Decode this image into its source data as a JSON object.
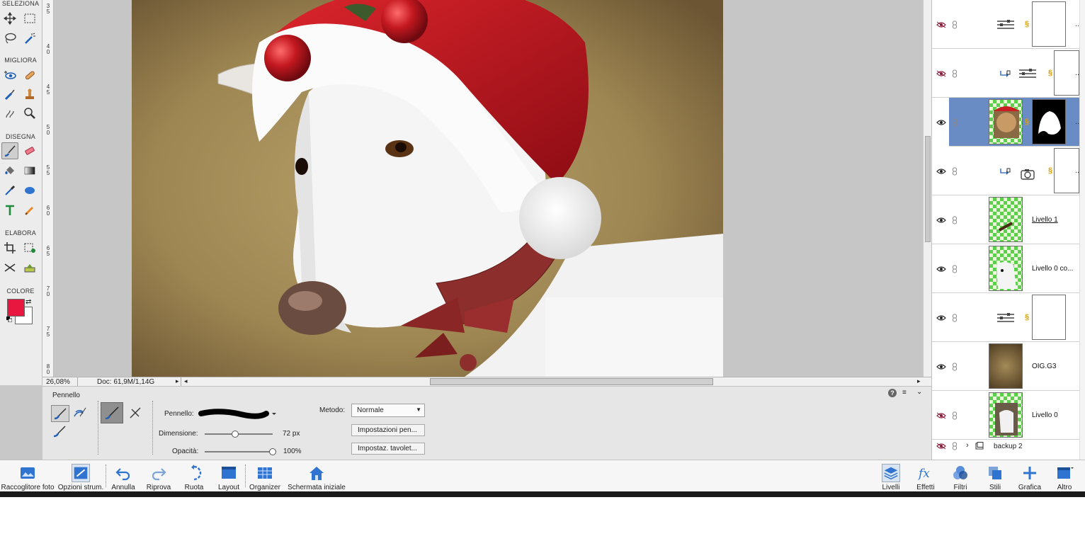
{
  "toolbox": {
    "sections": [
      "SELEZIONA",
      "MIGLIORA",
      "DISEGNA",
      "ELABORA",
      "COLORE"
    ],
    "foreground_color": "#e8173f",
    "background_color": "#ffffff"
  },
  "ruler": {
    "ticks": [
      "3\n5",
      "4\n0",
      "4\n5",
      "5\n0",
      "5\n5",
      "6\n0",
      "6\n5",
      "7\n0",
      "7\n5",
      "8\n0"
    ]
  },
  "status": {
    "zoom": "26,08%",
    "doc": "Doc: 61,9M/1,14G"
  },
  "options": {
    "tool_name": "Pennello",
    "brush_label": "Pennello:",
    "size_label": "Dimensione:",
    "size_value": "72 px",
    "size_level_pct": 45,
    "opacity_label": "Opacità:",
    "opacity_value": "100%",
    "opacity_level_pct": 100,
    "mode_label": "Metodo:",
    "mode_value": "Normale",
    "pen_settings": "Impostazioni pen...",
    "tablet_settings": "Impostaz. tavolet..."
  },
  "layers": [
    {
      "name": "",
      "visible": false,
      "type": "adjustment",
      "more": "..."
    },
    {
      "name": "",
      "visible": false,
      "type": "adjustment-clip",
      "more": "..."
    },
    {
      "name": "",
      "visible": true,
      "type": "photo-mask",
      "selected": true,
      "more": "..."
    },
    {
      "name": "",
      "visible": true,
      "type": "camera-clip",
      "more": "..."
    },
    {
      "name": "Livello 1",
      "visible": true,
      "type": "pixel"
    },
    {
      "name": "Livello 0 co...",
      "visible": true,
      "type": "pixel-dog"
    },
    {
      "name": "",
      "visible": true,
      "type": "adjustment-plain"
    },
    {
      "name": "OIG.G3",
      "visible": true,
      "type": "texture"
    },
    {
      "name": "Livello 0",
      "visible": false,
      "type": "pixel-dog2"
    }
  ],
  "group": {
    "name": "backup 2",
    "visible": false
  },
  "taskbar": {
    "left": [
      {
        "label": "Raccoglitore foto",
        "icon": "photo-bin-icon"
      },
      {
        "label": "Opzioni strum.",
        "icon": "tool-options-icon"
      },
      {
        "label": "Annulla",
        "icon": "undo-icon"
      },
      {
        "label": "Riprova",
        "icon": "redo-icon"
      },
      {
        "label": "Ruota",
        "icon": "rotate-icon"
      },
      {
        "label": "Layout",
        "icon": "layout-icon"
      },
      {
        "label": "Organizer",
        "icon": "organizer-icon"
      },
      {
        "label": "Schermata iniziale",
        "icon": "home-icon"
      }
    ],
    "right": [
      {
        "label": "Livelli",
        "icon": "layers-icon"
      },
      {
        "label": "Effetti",
        "icon": "fx-icon"
      },
      {
        "label": "Filtri",
        "icon": "filters-icon"
      },
      {
        "label": "Stili",
        "icon": "styles-icon"
      },
      {
        "label": "Grafica",
        "icon": "graphics-icon"
      },
      {
        "label": "Altro",
        "icon": "more-icon"
      }
    ]
  }
}
